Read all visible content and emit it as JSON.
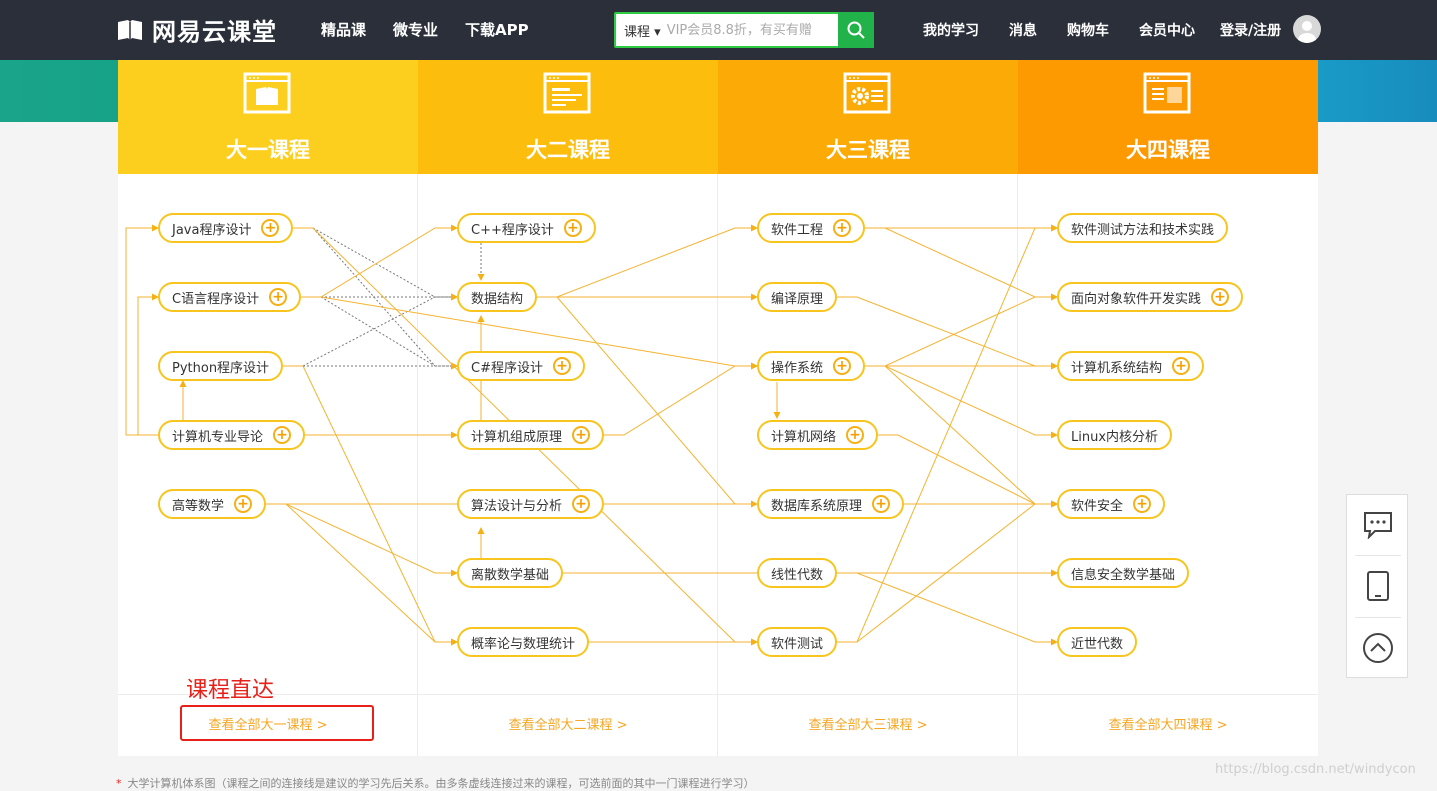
{
  "header": {
    "logo_text": "网易云课堂",
    "nav": [
      "精品课",
      "微专业",
      "下载APP"
    ],
    "search": {
      "category": "课程",
      "placeholder": "VIP会员8.8折，有买有赠"
    },
    "right_nav": [
      "我的学习",
      "消息",
      "购物车",
      "会员中心",
      "登录/注册"
    ]
  },
  "columns": [
    {
      "title": "大一课程",
      "view_all": "查看全部大一课程 >",
      "color": "#fccf1e"
    },
    {
      "title": "大二课程",
      "view_all": "查看全部大二课程 >",
      "color": "#fcbd0d"
    },
    {
      "title": "大三课程",
      "view_all": "查看全部大三课程 >",
      "color": "#fcaa06"
    },
    {
      "title": "大四课程",
      "view_all": "查看全部大四课程 >",
      "color": "#fd9a02"
    }
  ],
  "courses": {
    "y1": [
      "Java程序设计",
      "C语言程序设计",
      "Python程序设计",
      "计算机专业导论",
      "高等数学"
    ],
    "y2": [
      "C++程序设计",
      "数据结构",
      "C#程序设计",
      "计算机组成原理",
      "算法设计与分析",
      "离散数学基础",
      "概率论与数理统计"
    ],
    "y3": [
      "软件工程",
      "编译原理",
      "操作系统",
      "计算机网络",
      "数据库系统原理",
      "线性代数",
      "软件测试"
    ],
    "y4": [
      "软件测试方法和技术实践",
      "面向对象软件开发实践",
      "计算机系统结构",
      "Linux内核分析",
      "软件安全",
      "信息安全数学基础",
      "近世代数"
    ]
  },
  "annotation": "课程直达",
  "footnote": "大学计算机体系图（课程之间的连接线是建议的学习先后关系。由多条虚线连接过来的课程，可选前面的其中一门课程进行学习）",
  "footnote_mark": "*",
  "watermark": "https://blog.csdn.net/windycon",
  "side": [
    "chat-icon",
    "tablet-icon",
    "back-to-top-icon"
  ],
  "colors": {
    "accent": "#f5a623",
    "topbar": "#2b2f3a",
    "search_green": "#21b24a",
    "annotation_red": "#e8201a"
  }
}
